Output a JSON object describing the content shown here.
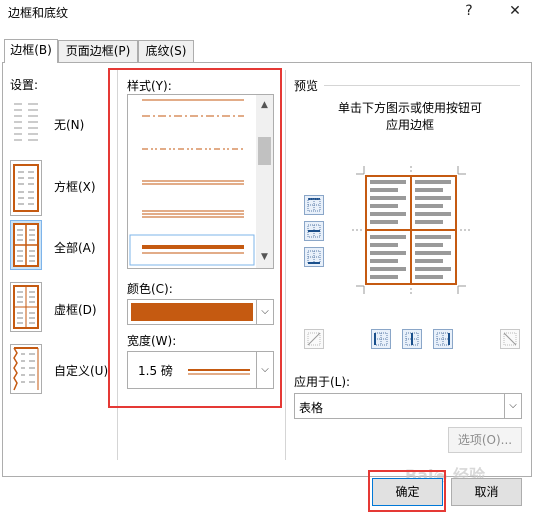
{
  "window": {
    "title": "边框和底纹",
    "help_label": "?",
    "close_label": "✕"
  },
  "tabs": [
    {
      "label": "边框(B)",
      "active": true
    },
    {
      "label": "页面边框(P)",
      "active": false
    },
    {
      "label": "底纹(S)",
      "active": false
    }
  ],
  "settings": {
    "label": "设置:",
    "items": [
      {
        "label": "无(N)",
        "icon": "border-none-icon",
        "selected": false
      },
      {
        "label": "方框(X)",
        "icon": "border-box-icon",
        "selected": false
      },
      {
        "label": "全部(A)",
        "icon": "border-all-icon",
        "selected": true
      },
      {
        "label": "虚框(D)",
        "icon": "border-grid-icon",
        "selected": false
      },
      {
        "label": "自定义(U)",
        "icon": "border-custom-icon",
        "selected": false
      }
    ]
  },
  "style": {
    "label": "样式(Y):",
    "items": [
      "dash-dot",
      "dash-dot-dot",
      "double",
      "triple",
      "thick-thin-selected"
    ]
  },
  "color": {
    "label": "颜色(C):",
    "value": "#c55a11"
  },
  "width": {
    "label": "宽度(W):",
    "value": "1.5 磅"
  },
  "preview": {
    "label": "预览",
    "hint_line1": "单击下方图示或使用按钮可",
    "hint_line2": "应用边框"
  },
  "apply_to": {
    "label": "应用于(L):",
    "value": "表格"
  },
  "buttons": {
    "options": "选项(O)...",
    "ok": "确定",
    "cancel": "取消"
  },
  "colors": {
    "border": "#c55a11",
    "highlight": "#e53935"
  }
}
